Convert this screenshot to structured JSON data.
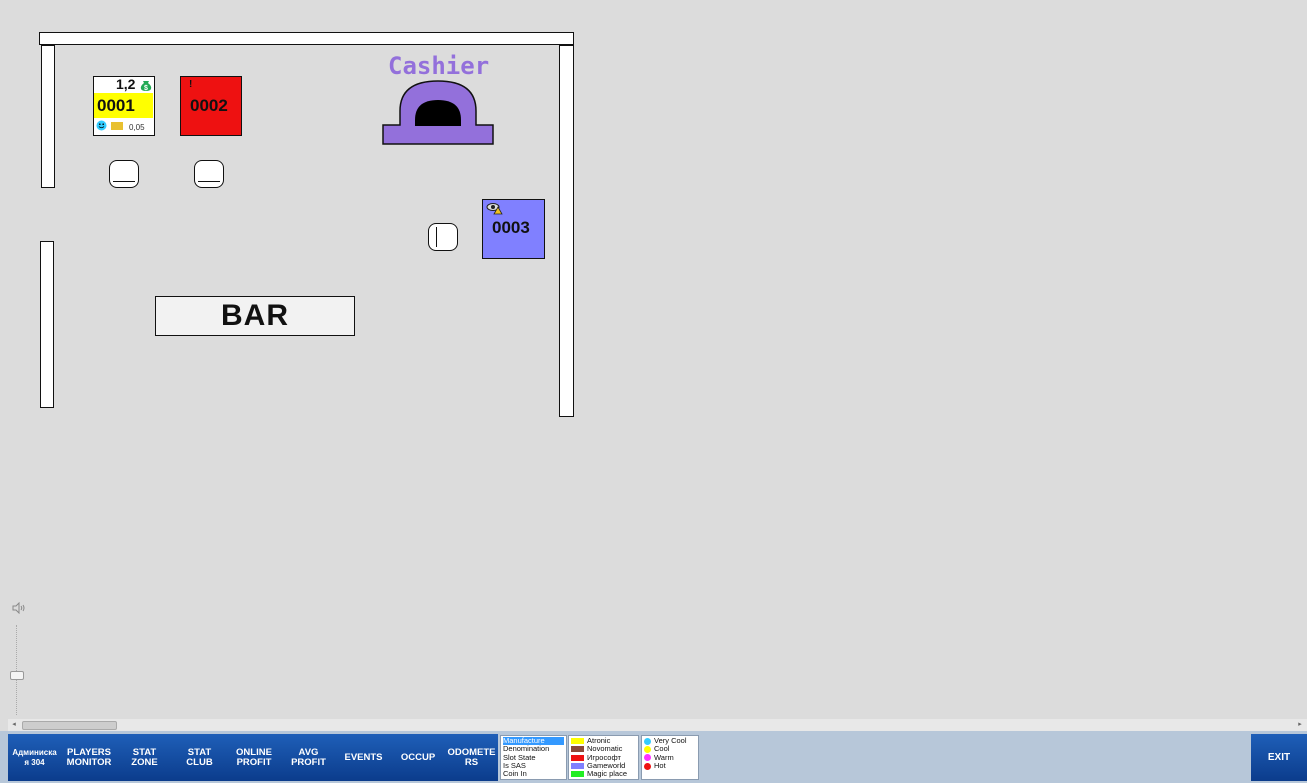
{
  "floor": {
    "cashier_label": "Cashier",
    "bar_label": "BAR"
  },
  "slots": [
    {
      "number": "0001",
      "top_value": "1,2",
      "denom": "0,05",
      "color": "#ffff00",
      "state": "very-cool"
    },
    {
      "number": "0002",
      "marker": "!",
      "color": "#ee1111"
    },
    {
      "number": "0003",
      "color": "#8080ff"
    }
  ],
  "bottom_bar": {
    "buttons": [
      {
        "label": "Админиска\nя 304"
      },
      {
        "label": "PLAYERS\nMONITOR"
      },
      {
        "label": "STAT\nZONE"
      },
      {
        "label": "STAT\nCLUB"
      },
      {
        "label": "ONLINE\nPROFIT"
      },
      {
        "label": "AVG\nPROFIT"
      },
      {
        "label": "EVENTS"
      },
      {
        "label": "OCCUP"
      },
      {
        "label": "ODOMETE\nRS"
      }
    ],
    "filter_list": [
      "Manufacture",
      "Denomination",
      "Slot State",
      "Is SAS",
      "Coin In"
    ],
    "filter_selected": "Manufacture",
    "manufacturers": [
      {
        "name": "Atronic",
        "color": "#ffff00"
      },
      {
        "name": "Novomatic",
        "color": "#8b4a3a"
      },
      {
        "name": "Игрософт",
        "color": "#ee1111"
      },
      {
        "name": "Gameworld",
        "color": "#8080ff"
      },
      {
        "name": "Magic place",
        "color": "#22ee22"
      }
    ],
    "temperatures": [
      {
        "name": "Very Cool",
        "color": "#33ccff"
      },
      {
        "name": "Cool",
        "color": "#ffff00"
      },
      {
        "name": "Warm",
        "color": "#ff33ff"
      },
      {
        "name": "Hot",
        "color": "#ee1111"
      }
    ],
    "exit_label": "EXIT"
  }
}
